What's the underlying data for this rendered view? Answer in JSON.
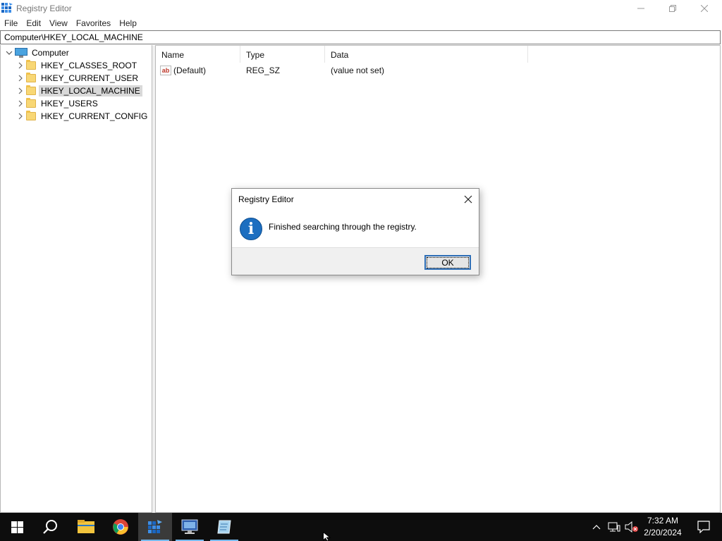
{
  "window": {
    "title": "Registry Editor",
    "icon": "registry-editor-icon"
  },
  "menu": [
    "File",
    "Edit",
    "View",
    "Favorites",
    "Help"
  ],
  "address": "Computer\\HKEY_LOCAL_MACHINE",
  "tree": {
    "root": "Computer",
    "items": [
      {
        "label": "HKEY_CLASSES_ROOT",
        "selected": false
      },
      {
        "label": "HKEY_CURRENT_USER",
        "selected": false
      },
      {
        "label": "HKEY_LOCAL_MACHINE",
        "selected": true
      },
      {
        "label": "HKEY_USERS",
        "selected": false
      },
      {
        "label": "HKEY_CURRENT_CONFIG",
        "selected": false
      }
    ]
  },
  "list": {
    "columns": [
      "Name",
      "Type",
      "Data"
    ],
    "rows": [
      {
        "name": "(Default)",
        "type": "REG_SZ",
        "data": "(value not set)"
      }
    ]
  },
  "dialog": {
    "title": "Registry Editor",
    "message": "Finished searching through the registry.",
    "ok_label": "OK",
    "icon": "information-icon"
  },
  "taskbar": {
    "apps": [
      "start",
      "search",
      "file-explorer",
      "chrome",
      "registry-editor",
      "remote-desktop",
      "notepad"
    ],
    "active_app": "registry-editor",
    "time": "7:32 AM",
    "date": "2/20/2024"
  },
  "colors": {
    "accent": "#1c6ec0",
    "selection": "#d9d9d9",
    "taskbar": "#0d0d0d"
  }
}
